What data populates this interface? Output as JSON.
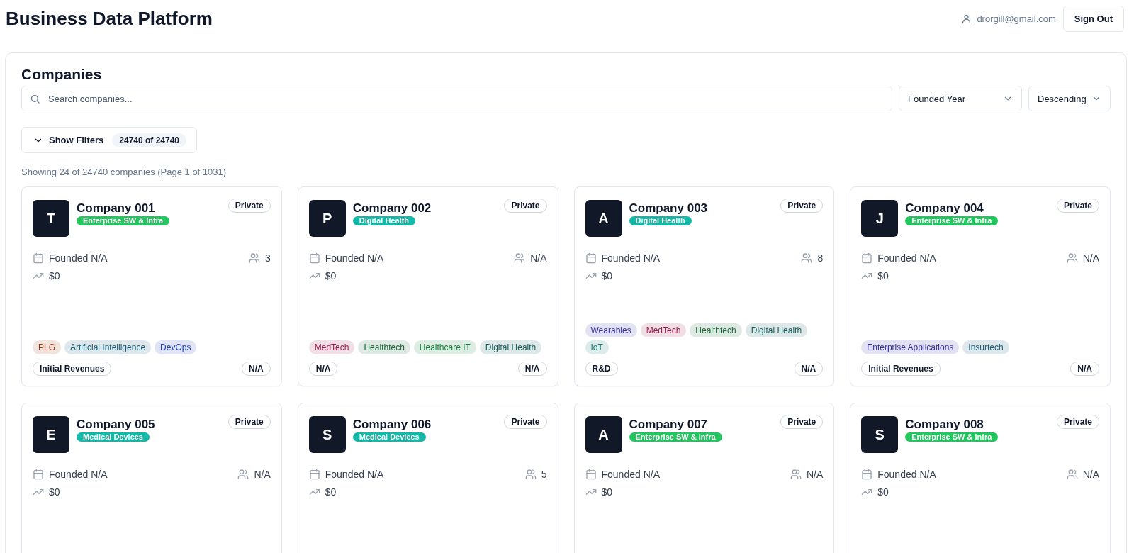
{
  "header": {
    "title": "Business Data Platform",
    "user_email": "drorgill@gmail.com",
    "sign_out": "Sign Out"
  },
  "panel": {
    "title": "Companies",
    "search": {
      "placeholder": "Search companies..."
    },
    "sort_field": "Founded Year",
    "sort_order": "Descending",
    "filters_button": {
      "label": "Show Filters",
      "expanded": false,
      "count": "24740 of 24740"
    },
    "summary": "Showing 24 of 24740 companies (Page 1 of 1031)"
  },
  "companies": [
    {
      "initial": "T",
      "name": "Company 001",
      "sector": {
        "label": "Enterprise SW & Infra",
        "color": "#22c55e"
      },
      "status": "Private",
      "founded": "Founded N/A",
      "employees": "3",
      "funding": "$0",
      "tags": [
        {
          "label": "PLG",
          "color": "#9a3412"
        },
        {
          "label": "Artificial Intelligence",
          "color": "#155e75"
        },
        {
          "label": "DevOps",
          "color": "#1e40af"
        }
      ],
      "stage": "Initial Revenues",
      "footer_value": "N/A"
    },
    {
      "initial": "P",
      "name": "Company 002",
      "sector": {
        "label": "Digital Health",
        "color": "#14b8a6"
      },
      "status": "Private",
      "founded": "Founded N/A",
      "employees": "N/A",
      "funding": "$0",
      "tags": [
        {
          "label": "MedTech",
          "color": "#9d174d"
        },
        {
          "label": "Healthtech",
          "color": "#166534"
        },
        {
          "label": "Healthcare IT",
          "color": "#15803d"
        },
        {
          "label": "Digital Health",
          "color": "#115e59"
        }
      ],
      "stage": "N/A",
      "footer_value": "N/A"
    },
    {
      "initial": "A",
      "name": "Company 003",
      "sector": {
        "label": "Digital Health",
        "color": "#14b8a6"
      },
      "status": "Private",
      "founded": "Founded N/A",
      "employees": "8",
      "funding": "$0",
      "tags": [
        {
          "label": "Wearables",
          "color": "#3730a3"
        },
        {
          "label": "MedTech",
          "color": "#9d174d"
        },
        {
          "label": "Healthtech",
          "color": "#166534"
        },
        {
          "label": "Digital Health",
          "color": "#115e59"
        },
        {
          "label": "IoT",
          "color": "#0f766e"
        }
      ],
      "stage": "R&D",
      "footer_value": "N/A"
    },
    {
      "initial": "J",
      "name": "Company 004",
      "sector": {
        "label": "Enterprise SW & Infra",
        "color": "#22c55e"
      },
      "status": "Private",
      "founded": "Founded N/A",
      "employees": "N/A",
      "funding": "$0",
      "tags": [
        {
          "label": "Enterprise Applications",
          "color": "#3730a3"
        },
        {
          "label": "Insurtech",
          "color": "#155e75"
        }
      ],
      "stage": "Initial Revenues",
      "footer_value": "N/A"
    },
    {
      "initial": "E",
      "name": "Company 005",
      "sector": {
        "label": "Medical Devices",
        "color": "#14b8a6"
      },
      "status": "Private",
      "founded": "Founded N/A",
      "employees": "N/A",
      "funding": "$0"
    },
    {
      "initial": "S",
      "name": "Company 006",
      "sector": {
        "label": "Medical Devices",
        "color": "#14b8a6"
      },
      "status": "Private",
      "founded": "Founded N/A",
      "employees": "5",
      "funding": "$0"
    },
    {
      "initial": "A",
      "name": "Company 007",
      "sector": {
        "label": "Enterprise SW & Infra",
        "color": "#22c55e"
      },
      "status": "Private",
      "founded": "Founded N/A",
      "employees": "N/A",
      "funding": "$0"
    },
    {
      "initial": "S",
      "name": "Company 008",
      "sector": {
        "label": "Enterprise SW & Infra",
        "color": "#22c55e"
      },
      "status": "Private",
      "founded": "Founded N/A",
      "employees": "N/A",
      "funding": "$0"
    }
  ]
}
